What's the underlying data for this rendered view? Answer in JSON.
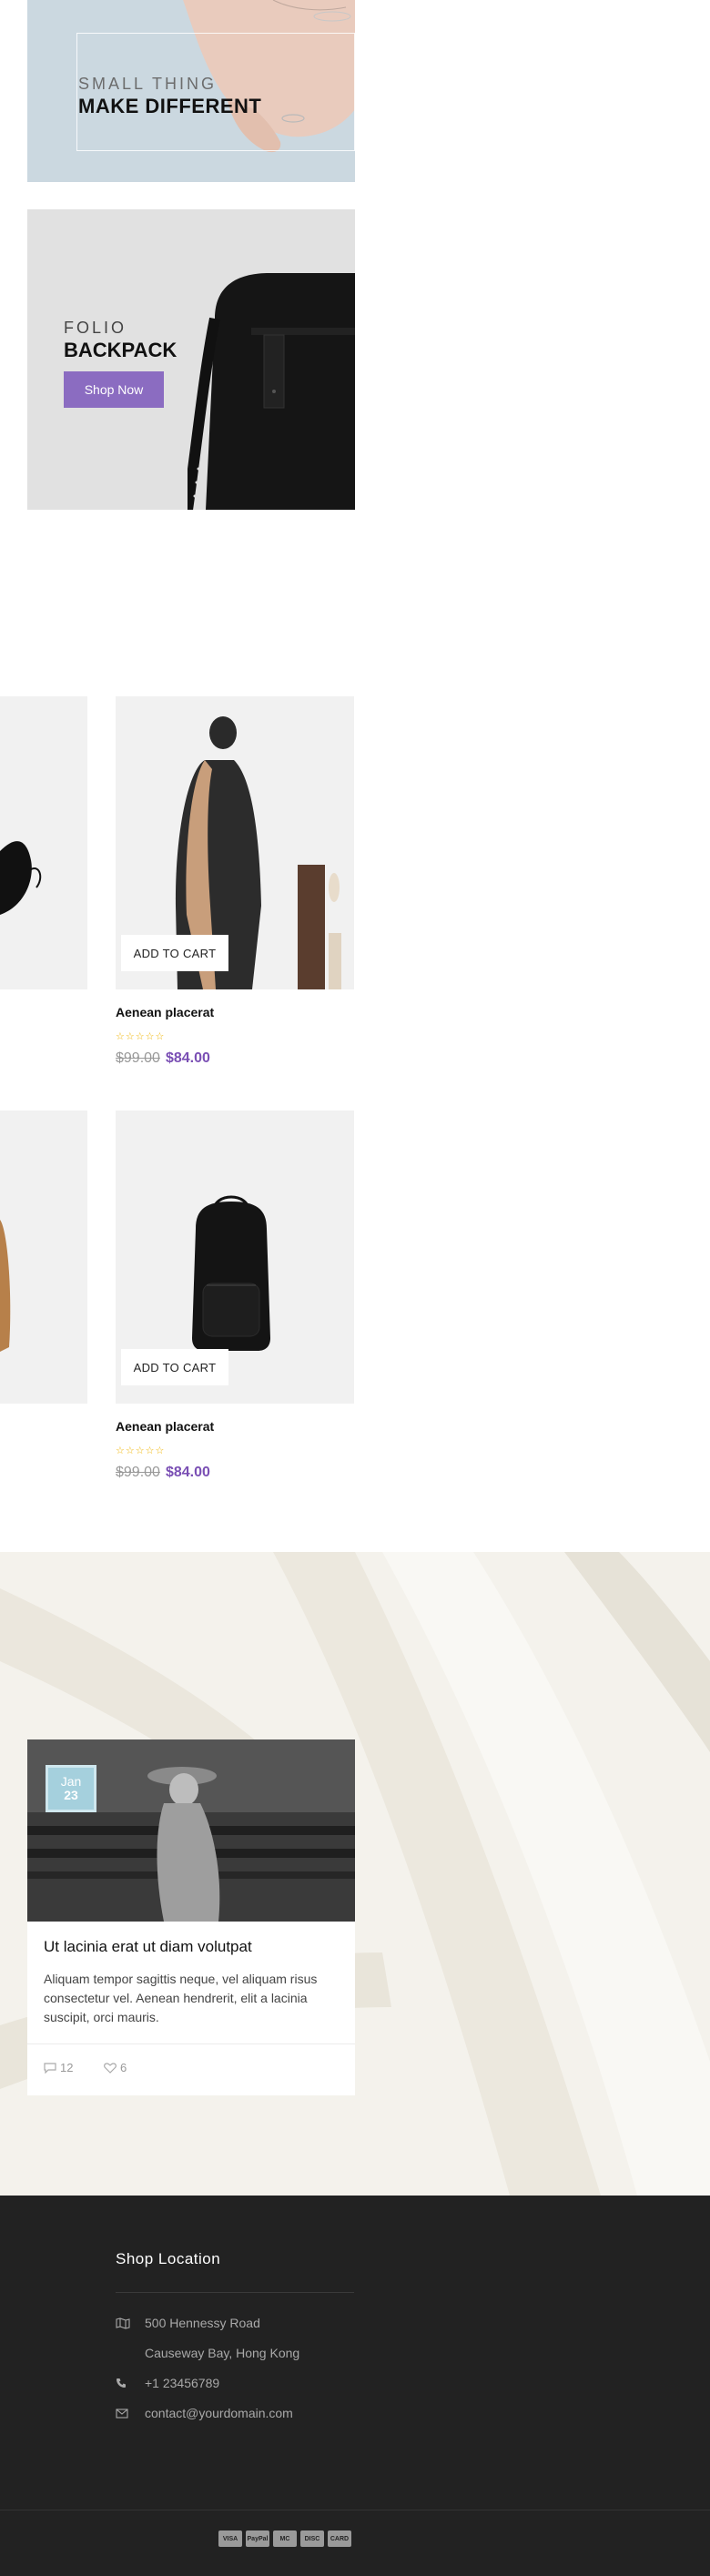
{
  "banners": {
    "first": {
      "small_text": "SMALL THING",
      "big_text": "MAKE DIFFERENT"
    },
    "second": {
      "small_text": "FOLIO",
      "big_text": "BACKPACK",
      "button_label": "Shop Now"
    }
  },
  "products": [
    {
      "name": "Aenean placerat",
      "old_price": "$99.00",
      "new_price": "$84.00",
      "rating": 0,
      "add_to_cart_label": "ADD TO CART"
    },
    {
      "name": "Aenean placerat",
      "old_price": "$99.00",
      "new_price": "$84.00",
      "rating": 0,
      "add_to_cart_label": "ADD TO CART"
    }
  ],
  "rating_stars": "☆☆☆☆☆",
  "blog": {
    "date_month": "Jan",
    "date_day": "23",
    "title": "Ut lacinia erat ut diam volutpat",
    "excerpt": "Aliquam tempor sagittis neque, vel aliquam risus consectetur vel. Aenean hendrerit, elit a lacinia suscipit, orci mauris.",
    "comments": "12",
    "likes": "6"
  },
  "footer": {
    "heading": "Shop Location",
    "address_line1": "500 Hennessy Road",
    "address_line2": "Causeway Bay, Hong Kong",
    "phone": "+1 23456789",
    "email": "contact@yourdomain.com",
    "payments": [
      "VISA",
      "PayPal",
      "MC",
      "DISC",
      "CARD"
    ]
  },
  "colors": {
    "accent": "#8b6cc1",
    "price": "#7a4fb4",
    "star": "#f0b400",
    "footer_bg": "#222222",
    "date_badge": "#a5d0dd"
  }
}
